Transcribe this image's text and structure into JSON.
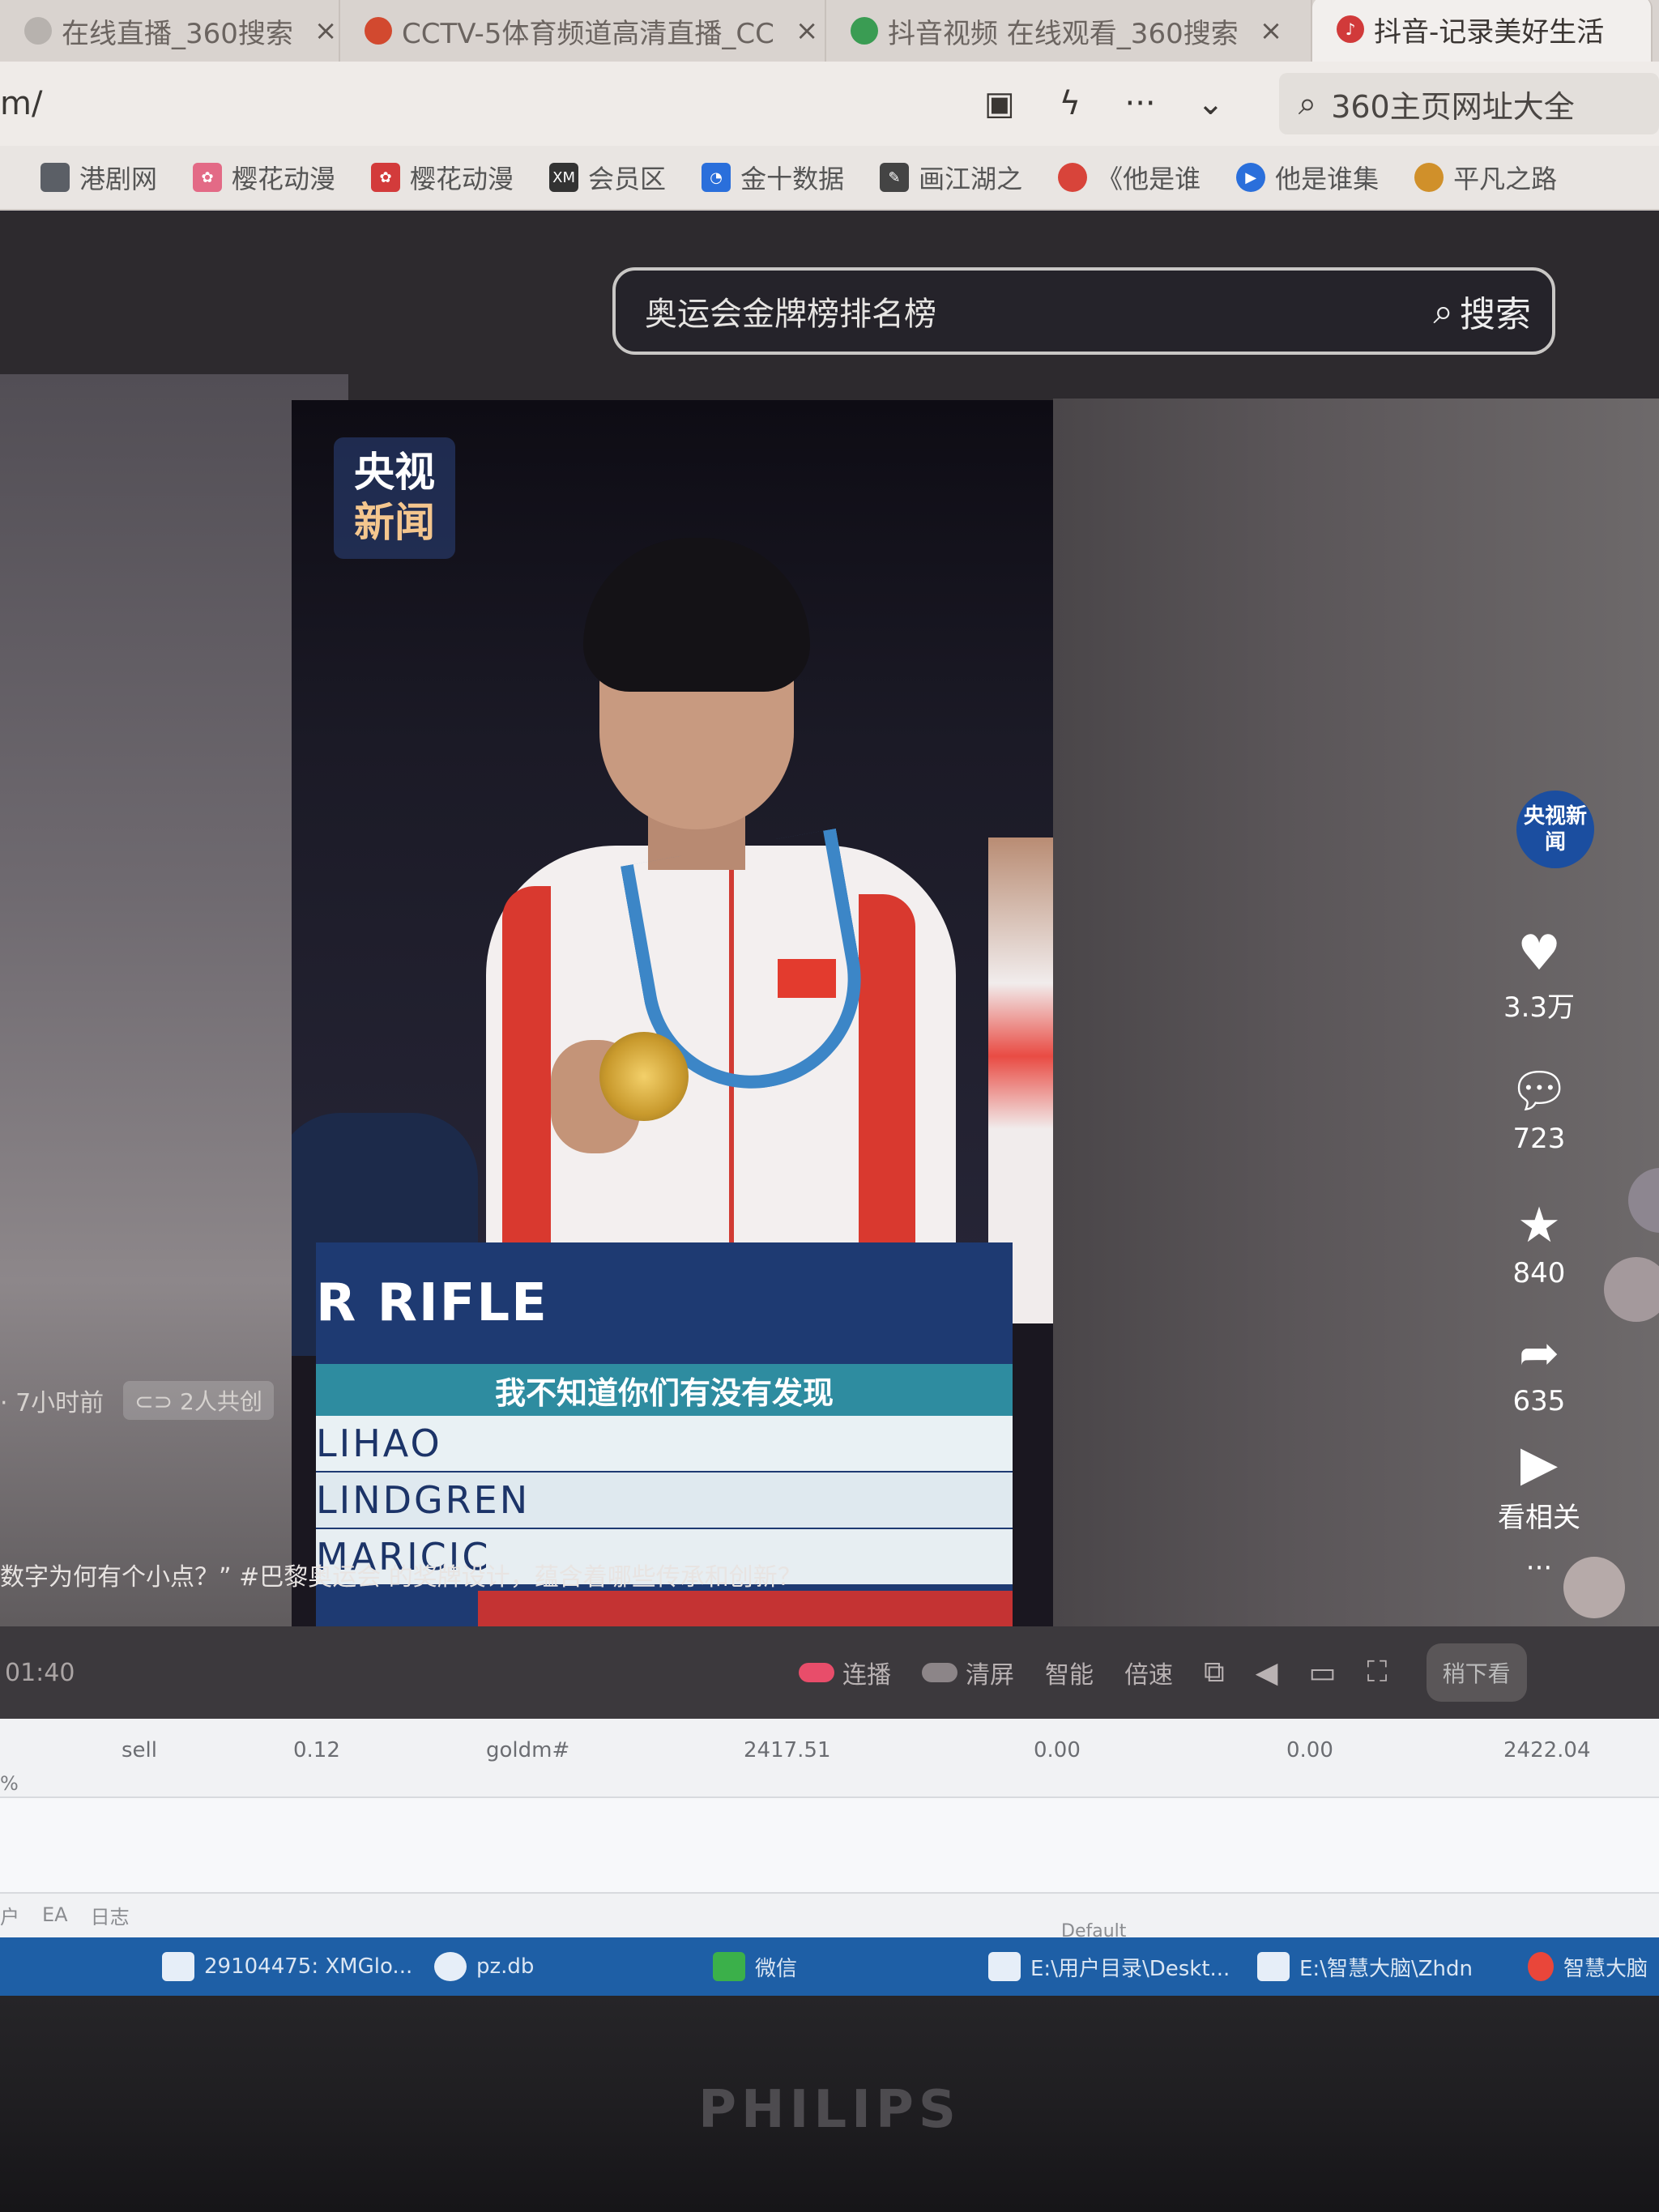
{
  "browser": {
    "tabs": [
      {
        "label": "在线直播_360搜索",
        "favicon_color": "#b7b2ae",
        "active": false
      },
      {
        "label": "CCTV-5体育频道高清直播_CC",
        "favicon_color": "#d2492f",
        "active": false
      },
      {
        "label": "抖音视频 在线观看_360搜索",
        "favicon_color": "#3a9c53",
        "active": false
      },
      {
        "label": "抖音-记录美好生活",
        "favicon_color": "#d13a3a",
        "active": true
      }
    ],
    "url": "m/",
    "toolbar_icons": [
      "image-icon",
      "lightning-icon",
      "more-icon",
      "chevron-down-icon"
    ],
    "search_placeholder": "360主页网址大全",
    "bookmarks": [
      {
        "label": "港剧网",
        "icon_color": "#5b5f66"
      },
      {
        "label": "樱花动漫",
        "icon_color": "#e36a86"
      },
      {
        "label": "樱花动漫",
        "icon_color": "#d33b3b"
      },
      {
        "label": "会员区",
        "icon_color": "#333333",
        "icon_text": "XM"
      },
      {
        "label": "金十数据",
        "icon_color": "#2a6fdb"
      },
      {
        "label": "画江湖之",
        "icon_color": "#444444"
      },
      {
        "label": "《他是谁",
        "icon_color": "#d8443a"
      },
      {
        "label": "他是谁集",
        "icon_color": "#2a6fdb"
      },
      {
        "label": "平凡之路",
        "icon_color": "#d0902a"
      }
    ]
  },
  "douyin": {
    "search_query": "奥运会金牌榜排名榜",
    "search_button": "搜索",
    "video": {
      "logo_line1": "央视",
      "logo_line2": "新闻",
      "board_title": "R RIFLE",
      "subtitle": "我不知道你们有没有发现",
      "board_rows": [
        "LIHAO",
        "LINDGREN",
        "MARICIC"
      ]
    },
    "author_meta": "· 7小时前",
    "share_badge": "2人共创",
    "description": "数字为何有个小点？” #巴黎奥运会 的奖牌设计，蕴含着哪些传承和创新？",
    "side_avatar": "央视新闻",
    "actions": {
      "likes": "3.3万",
      "comments": "723",
      "favorites": "840",
      "shares": "635",
      "related": "看相关",
      "more": "···"
    },
    "controls": {
      "time": "01:40",
      "autoplay": "连播",
      "clear": "清屏",
      "smart": "智能",
      "speed": "倍速",
      "watch_later": "稍下看"
    }
  },
  "terminal": {
    "row": [
      "sell",
      "0.12",
      "goldm#",
      "2417.51",
      "0.00",
      "0.00",
      "2422.04"
    ],
    "line2": "%",
    "tabs": [
      "户",
      "EA",
      "日志"
    ],
    "default_label": "Default"
  },
  "taskbar": [
    {
      "label": "29104475: XMGlo..."
    },
    {
      "label": "pz.db"
    },
    {
      "label": "微信"
    },
    {
      "label": "E:\\用户目录\\Deskt..."
    },
    {
      "label": "E:\\智慧大脑\\Zhdn"
    },
    {
      "label": "智慧大脑"
    }
  ],
  "monitor_brand": "PHILIPS"
}
